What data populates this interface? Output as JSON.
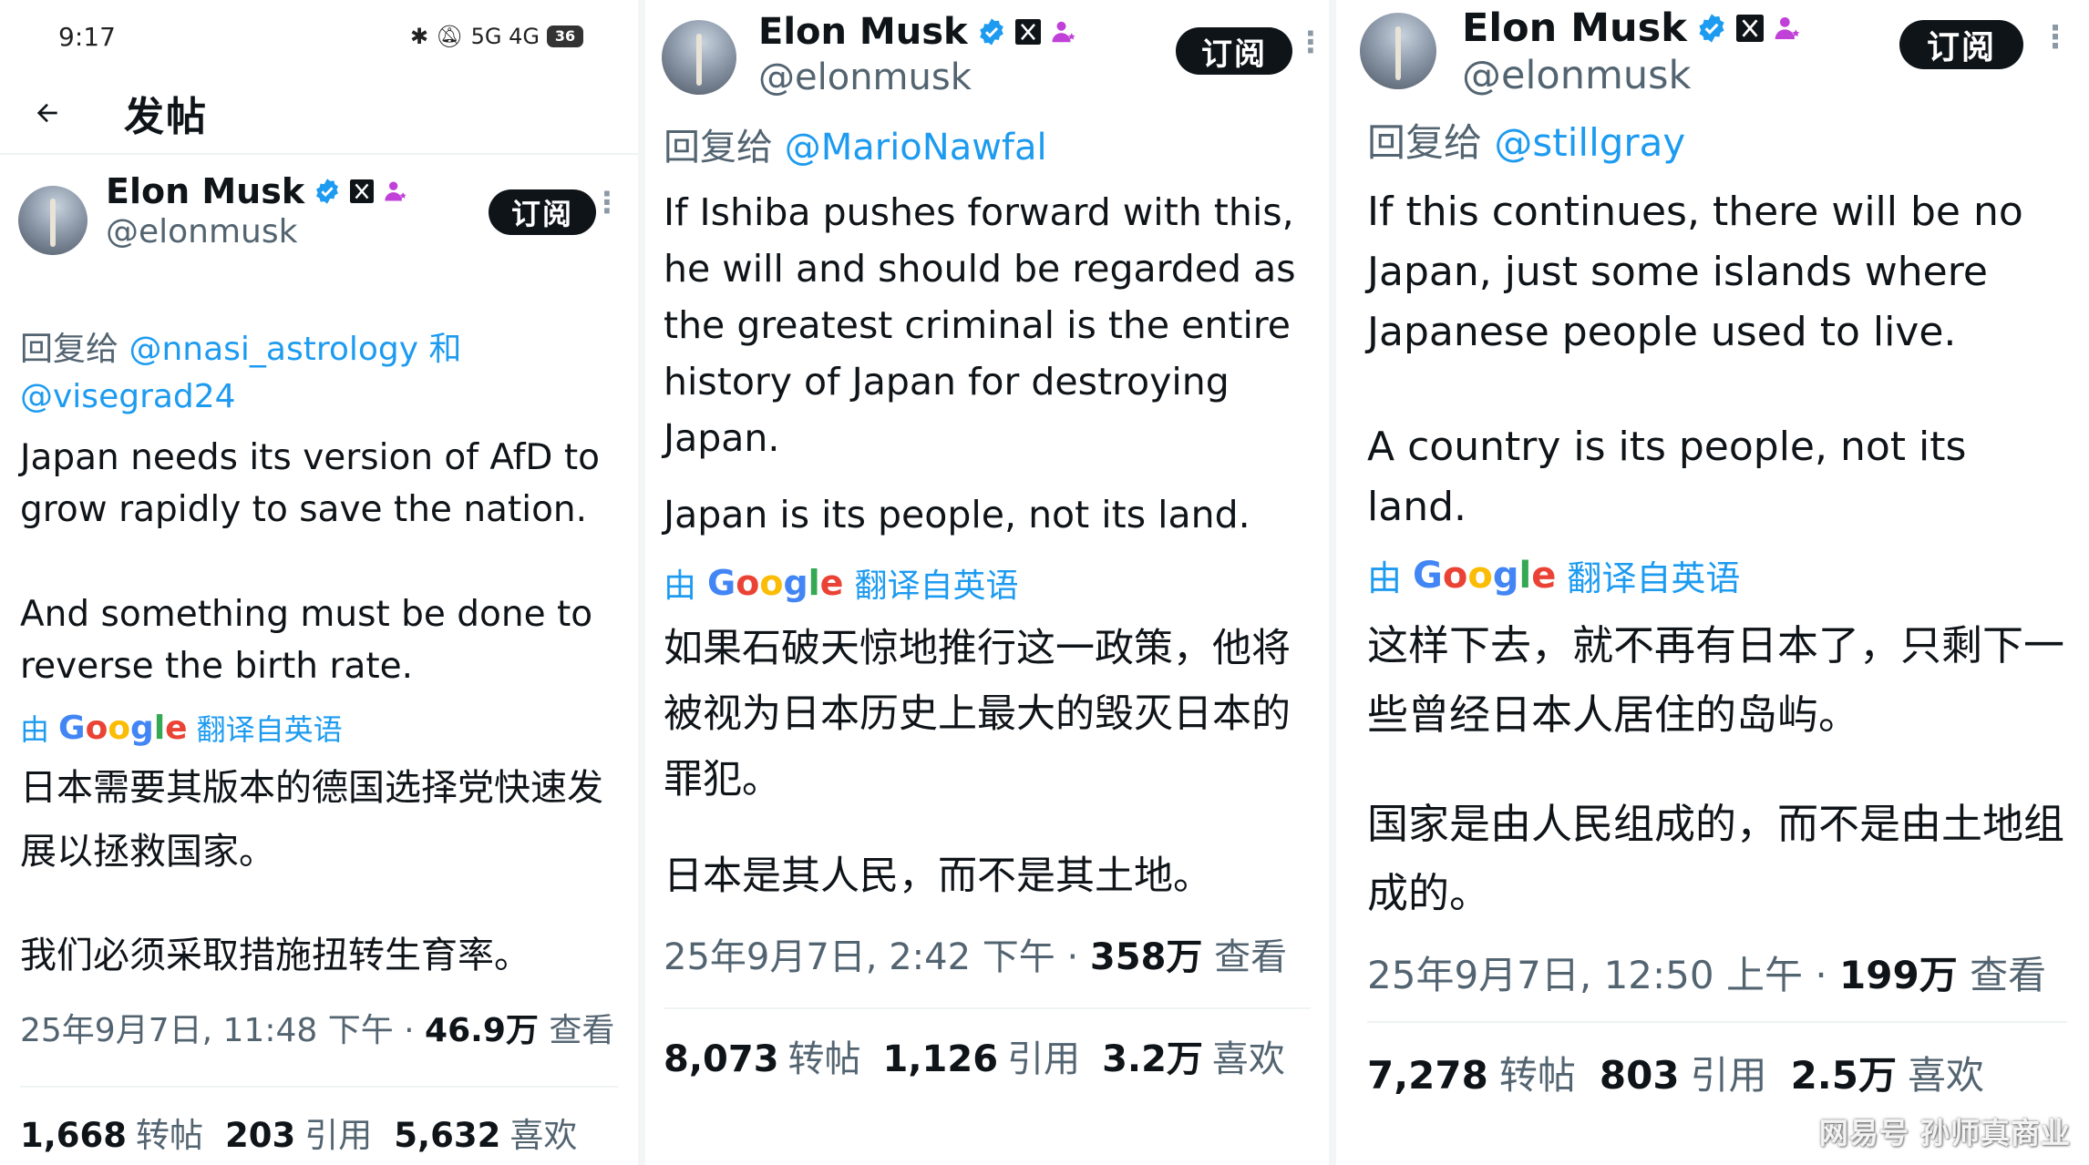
{
  "status_bar": {
    "time": "9:17",
    "signal_text": "5G 4G",
    "battery": "36"
  },
  "nav": {
    "title": "发帖"
  },
  "colors": {
    "link": "#1d9bf0",
    "verified": "#1d9bf0",
    "affiliate": "#c040d8",
    "button_bg": "#0f1419",
    "muted": "#536471"
  },
  "icons": [
    "back-arrow-icon",
    "verified-icon",
    "x-badge-icon",
    "affiliate-icon",
    "more-icon",
    "google-logo"
  ],
  "posts": [
    {
      "author": {
        "name": "Elon Musk",
        "handle": "@elonmusk"
      },
      "subscribe_label": "订阅",
      "more_label": "⋮",
      "reply_prefix": "回复给",
      "reply_mention_1": "@nnasi_astrology",
      "reply_and": "和",
      "reply_mention_2": "@visegrad24",
      "text_en_1": "Japan needs its version of AfD to grow rapidly to save the nation.",
      "text_en_2": "And something must be done to reverse the birth rate.",
      "translate_prefix": "由",
      "translate_brand": "Google",
      "translate_suffix": "翻译自英语",
      "text_zh_1": "日本需要其版本的德国选择党快速发展以拯救国家。",
      "text_zh_2": "我们必须采取措施扭转生育率。",
      "timestamp": "25年9月7日, 11:48 下午",
      "views_count": "46.9万",
      "views_label": "查看",
      "reposts_count": "1,668",
      "reposts_label": "转帖",
      "quotes_count": "203",
      "quotes_label": "引用",
      "likes_count": "5,632",
      "likes_label": "喜欢"
    },
    {
      "author": {
        "name": "Elon Musk",
        "handle": "@elonmusk"
      },
      "subscribe_label": "订阅",
      "more_label": "⋮",
      "reply_prefix": "回复给",
      "reply_mention_1": "@MarioNawfal",
      "text_en_1": "If Ishiba pushes forward with this, he will and should be regarded as the greatest criminal is the entire history of Japan for destroying Japan.",
      "text_en_2": "Japan is its people, not its land.",
      "translate_prefix": "由",
      "translate_brand": "Google",
      "translate_suffix": "翻译自英语",
      "text_zh_1": "如果石破天惊地推行这一政策，他将被视为日本历史上最大的毁灭日本的罪犯。",
      "text_zh_2": "日本是其人民，而不是其土地。",
      "timestamp": "25年9月7日, 2:42 下午",
      "views_count": "358万",
      "views_label": "查看",
      "reposts_count": "8,073",
      "reposts_label": "转帖",
      "quotes_count": "1,126",
      "quotes_label": "引用",
      "likes_count": "3.2万",
      "likes_label": "喜欢"
    },
    {
      "author": {
        "name": "Elon Musk",
        "handle": "@elonmusk"
      },
      "subscribe_label": "订阅",
      "more_label": "⋮",
      "reply_prefix": "回复给",
      "reply_mention_1": "@stillgray",
      "text_en_1": "If this continues, there will be no Japan, just some islands where Japanese people used to live.",
      "text_en_2": "A country is its people, not its land.",
      "translate_prefix": "由",
      "translate_brand": "Google",
      "translate_suffix": "翻译自英语",
      "text_zh_1": "这样下去，就不再有日本了，只剩下一些曾经日本人居住的岛屿。",
      "text_zh_2": "国家是由人民组成的，而不是由土地组成的。",
      "timestamp": "25年9月7日, 12:50 上午",
      "views_count": "199万",
      "views_label": "查看",
      "reposts_count": "7,278",
      "reposts_label": "转帖",
      "quotes_count": "803",
      "quotes_label": "引用",
      "likes_count": "2.5万",
      "likes_label": "喜欢"
    }
  ],
  "watermark": "网易号 孙师真商业"
}
